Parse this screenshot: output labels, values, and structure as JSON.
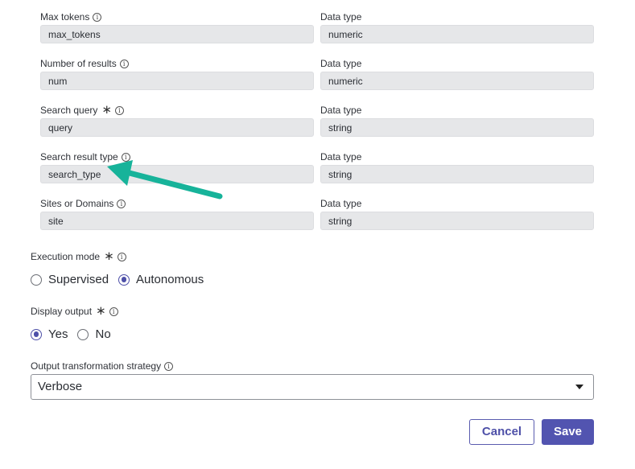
{
  "params": [
    {
      "label": "Max tokens",
      "required": false,
      "value": "max_tokens",
      "type_label": "Data type",
      "type_value": "numeric"
    },
    {
      "label": "Number of results",
      "required": false,
      "value": "num",
      "type_label": "Data type",
      "type_value": "numeric"
    },
    {
      "label": "Search query",
      "required": true,
      "value": "query",
      "type_label": "Data type",
      "type_value": "string"
    },
    {
      "label": "Search result type",
      "required": false,
      "value": "search_type",
      "type_label": "Data type",
      "type_value": "string"
    },
    {
      "label": "Sites or Domains",
      "required": false,
      "value": "site",
      "type_label": "Data type",
      "type_value": "string"
    }
  ],
  "execution_mode": {
    "label": "Execution mode",
    "options": [
      "Supervised",
      "Autonomous"
    ],
    "selected": "Autonomous"
  },
  "display_output": {
    "label": "Display output",
    "options": [
      "Yes",
      "No"
    ],
    "selected": "Yes"
  },
  "output_strategy": {
    "label": "Output transformation strategy",
    "value": "Verbose"
  },
  "buttons": {
    "cancel": "Cancel",
    "save": "Save"
  },
  "colors": {
    "accent": "#4e50a8",
    "arrow": "#17b39a",
    "field_bg": "#e6e7e9"
  }
}
